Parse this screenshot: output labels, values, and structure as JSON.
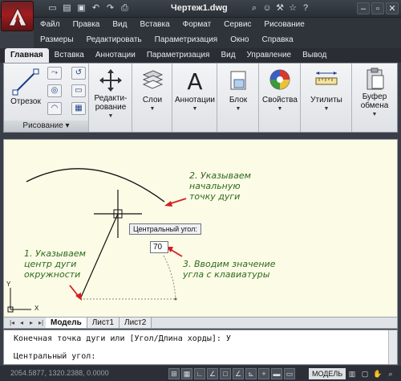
{
  "title_bar": {
    "document_title": "Чертеж1.dwg",
    "qat_icons": [
      "new-icon",
      "open-icon",
      "save-icon",
      "undo-icon",
      "redo-icon",
      "print-icon"
    ],
    "right_icons": [
      "binoculars-icon",
      "users-icon",
      "wrench-icon",
      "star-icon",
      "help-icon"
    ]
  },
  "menu": {
    "row1": [
      "Файл",
      "Правка",
      "Вид",
      "Вставка",
      "Формат",
      "Сервис",
      "Рисование"
    ],
    "row2": [
      "Размеры",
      "Редактировать",
      "Параметризация",
      "Окно",
      "Справка"
    ]
  },
  "ribbon_tabs": [
    "Главная",
    "Вставка",
    "Аннотации",
    "Параметризация",
    "Вид",
    "Управление",
    "Вывод"
  ],
  "ribbon": {
    "draw_panel_label": "Рисование",
    "line_button": "Отрезок",
    "modify_button": "Редакти-рование",
    "modify_line1": "Редакти-",
    "modify_line2": "рование",
    "layers_button": "Слои",
    "annotations_button": "Аннотации",
    "block_button": "Блок",
    "properties_button": "Свойства",
    "utilities_button": "Утилиты",
    "clipboard_line1": "Буфер",
    "clipboard_line2": "обмена"
  },
  "canvas": {
    "note1": [
      "1. Указываем",
      "центр дуги",
      "окружности"
    ],
    "note2": [
      "2. Указываем",
      "начальную",
      "точку дуги"
    ],
    "note3": [
      "3. Вводим значение",
      "угла с клавиатуры"
    ],
    "tooltip_label": "Центральный угол:",
    "angle_value": "70",
    "ucs_x": "X",
    "ucs_y": "Y"
  },
  "layout_tabs": [
    "Модель",
    "Лист1",
    "Лист2"
  ],
  "command_line": {
    "line1": "Конечная точка дуги или [Угол/Длина хорды]: У",
    "line2": "Центральный угол:"
  },
  "status_bar": {
    "coords": "2054.5877, 1320.2388, 0.0000",
    "model_label": "МОДЕЛЬ"
  },
  "colors": {
    "canvas_bg": "#fbfbe6",
    "annotation_green": "#2d6b1a",
    "arrow_red": "#d42020",
    "app_red": "#a21c1f"
  }
}
